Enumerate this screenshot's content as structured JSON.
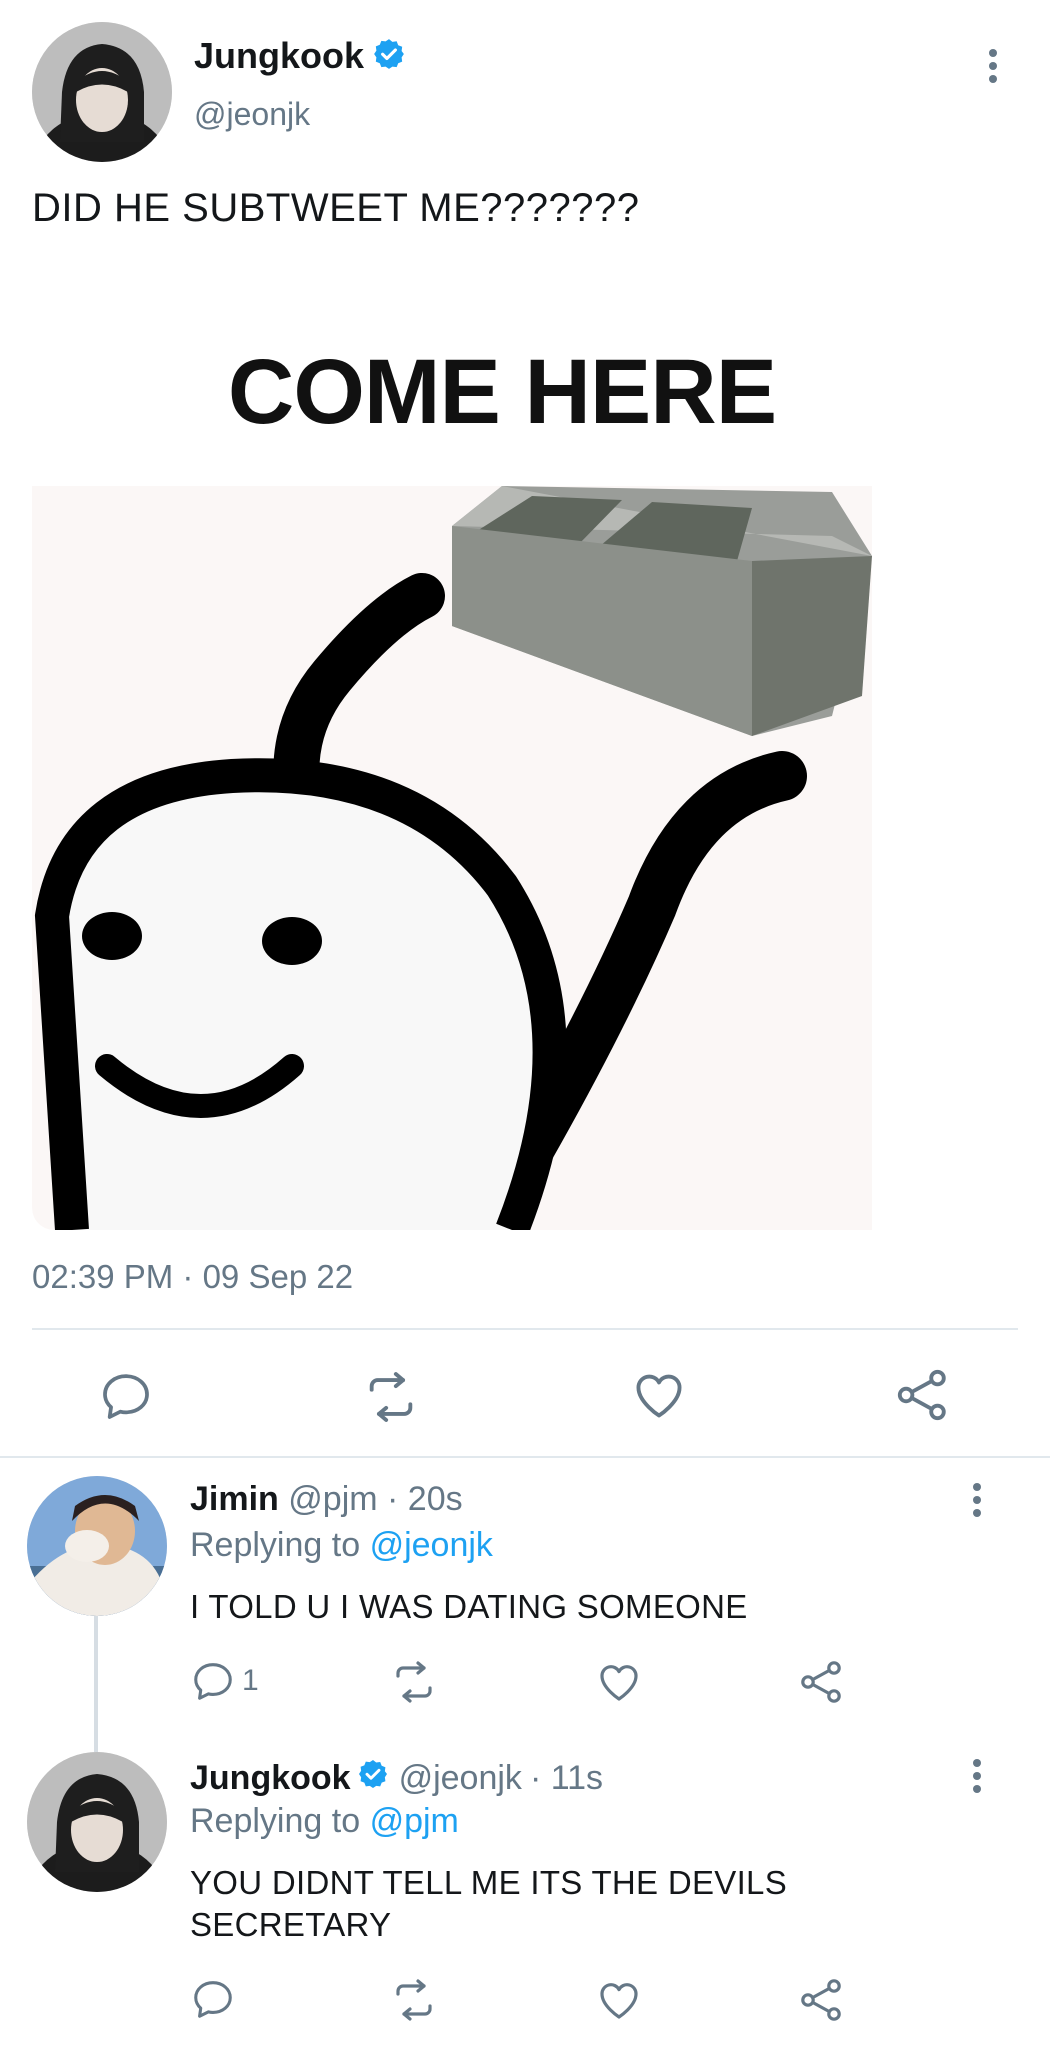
{
  "tweet": {
    "author_name": "Jungkook",
    "author_handle": "@jeonjk",
    "text": "DID HE SUBTWEET ME???????",
    "media_caption": "COME HERE",
    "timestamp": "02:39 PM · 09 Sep 22"
  },
  "replies": [
    {
      "author_name": "Jimin",
      "handle": "@pjm",
      "time": "· 20s",
      "replying_prefix": "Replying to",
      "replying_to": "@jeonjk",
      "text": "I TOLD U I WAS DATING SOMEONE",
      "reply_count": "1"
    },
    {
      "author_name": "Jungkook",
      "handle": "@jeonjk",
      "time": "· 11s",
      "replying_prefix": "Replying to",
      "replying_to": "@pjm",
      "text_line1": "YOU DIDNT TELL ME ITS THE DEVILS",
      "text_line2": "SECRETARY"
    }
  ],
  "colors": {
    "accent": "#1da1f2",
    "muted": "#657786",
    "divider": "#e1e8ed"
  }
}
